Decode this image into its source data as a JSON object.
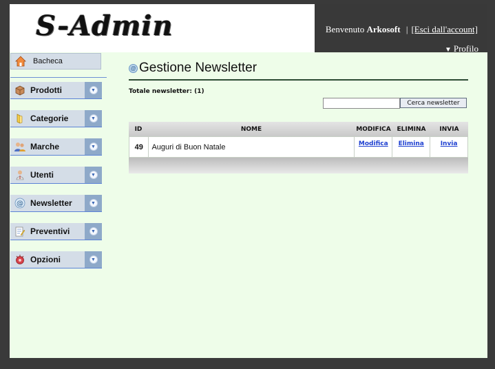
{
  "header": {
    "logo_text": "S-Admin",
    "welcome_prefix": "Benvenuto",
    "username": "Arkosoft",
    "separator": "|",
    "logout_label": "[Esci dall'account]",
    "profile_label": "Profilo"
  },
  "sidebar": {
    "home": {
      "label": "Bacheca",
      "icon": "home-icon"
    },
    "items": [
      {
        "label": "Prodotti",
        "icon": "box-icon"
      },
      {
        "label": "Categorie",
        "icon": "folder-icon"
      },
      {
        "label": "Marche",
        "icon": "users-icon"
      },
      {
        "label": "Utenti",
        "icon": "user-icon"
      },
      {
        "label": "Newsletter",
        "icon": "at-icon"
      },
      {
        "label": "Preventivi",
        "icon": "notepad-icon"
      },
      {
        "label": "Opzioni",
        "icon": "options-icon"
      }
    ]
  },
  "main": {
    "title": "Gestione Newsletter",
    "total_label": "Totale newsletter: (1)",
    "search": {
      "value": "",
      "button_label": "Cerca newsletter"
    },
    "table": {
      "columns": [
        "ID",
        "NOME",
        "MODIFICA",
        "ELIMINA",
        "INVIA"
      ],
      "rows": [
        {
          "id": "49",
          "name": "Auguri di Buon Natale",
          "edit": "Modifica",
          "delete": "Elimina",
          "send": "Invia"
        }
      ]
    }
  },
  "colors": {
    "background": "#3a3a3a",
    "content_bg": "#eefde9",
    "header_dark": "#393939",
    "nav_bg": "#d4dde7",
    "nav_expand": "#8ea9c9",
    "link": "#1d3fd0"
  }
}
